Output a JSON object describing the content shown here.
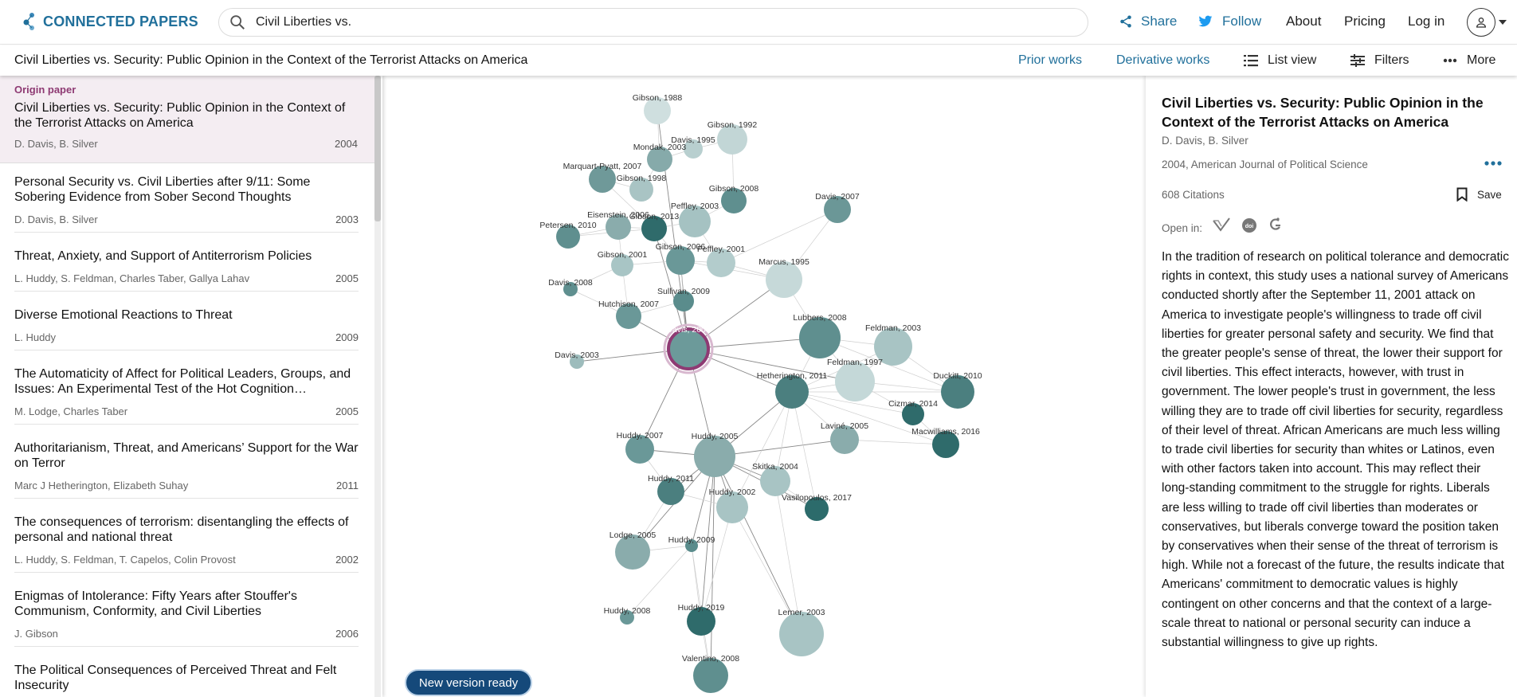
{
  "header": {
    "brand": "CONNECTED PAPERS",
    "search_value": "Civil Liberties vs.",
    "share": "Share",
    "follow": "Follow",
    "about": "About",
    "pricing": "Pricing",
    "login": "Log in",
    "colors": {
      "brand_blue": "#21709b",
      "twitter_blue": "#1d9bf0"
    }
  },
  "subbar": {
    "paper_title": "Civil Liberties vs. Security: Public Opinion in the Context of the Terrorist Attacks on America",
    "prior_works": "Prior works",
    "derivative_works": "Derivative works",
    "list_view": "List view",
    "filters": "Filters",
    "more": "More"
  },
  "list": {
    "origin_tag": "Origin paper",
    "items": [
      {
        "title": "Civil Liberties vs. Security: Public Opinion in the Context of the Terrorist Attacks on America",
        "authors": "D. Davis, B. Silver",
        "year": "2004"
      },
      {
        "title": "Personal Security vs. Civil Liberties after 9/11: Some Sobering Evidence from Sober Second Thoughts",
        "authors": "D. Davis, B. Silver",
        "year": "2003"
      },
      {
        "title": "Threat, Anxiety, and Support of Antiterrorism Policies",
        "authors": "L. Huddy, S. Feldman, Charles Taber, Gallya Lahav",
        "year": "2005"
      },
      {
        "title": "Diverse Emotional Reactions to Threat",
        "authors": "L. Huddy",
        "year": "2009"
      },
      {
        "title": "The Automaticity of Affect for Political Leaders, Groups, and Issues: An Experimental Test of the Hot Cognition…",
        "authors": "M. Lodge, Charles Taber",
        "year": "2005"
      },
      {
        "title": "Authoritarianism, Threat, and Americans’ Support for the War on Terror",
        "authors": "Marc J Hetherington, Elizabeth Suhay",
        "year": "2011"
      },
      {
        "title": "The consequences of terrorism: disentangling the effects of personal and national threat",
        "authors": "L. Huddy, S. Feldman, T. Capelos, Colin Provost",
        "year": "2002"
      },
      {
        "title": "Enigmas of Intolerance: Fifty Years after Stouffer's Communism, Conformity, and Civil Liberties",
        "authors": "J. Gibson",
        "year": "2006"
      },
      {
        "title": "The Political Consequences of Perceived Threat and Felt Insecurity",
        "authors": "",
        "year": ""
      }
    ]
  },
  "graph": {
    "new_version": "New version ready",
    "nodes": [
      "Gibson, 1988",
      "Gibson, 1992",
      "Davis, 1995",
      "Mondak, 2003",
      "Marquart-Pyatt, 2007",
      "Gibson, 1998",
      "Gibson, 2008",
      "Davis, 2007",
      "Peffley, 2003",
      "Eisenstein, 2006",
      "Gibson, 2013",
      "Petersen, 2010",
      "Gibson, 2006",
      "Peffley, 2001",
      "Gibson, 2001",
      "Marcus, 1995",
      "Davis, 2008",
      "Sullivan, 2009",
      "Hutchison, 2007",
      "Lubbers, 2008",
      "Feldman, 2003",
      "Davis, 2004",
      "Davis, 2003",
      "Feldman, 1997",
      "Hetherington, 2011",
      "Duckitt, 2010",
      "Cizmar, 2014",
      "Laviné, 2005",
      "Macwilliams, 2016",
      "Huddy, 2007",
      "Huddy, 2005",
      "Skitka, 2004",
      "Huddy, 2011",
      "Huddy, 2002",
      "Vasilopoulos, 2017",
      "Huddy, 2009",
      "Lodge, 2005",
      "Huddy, 2008",
      "Huddy, 2019",
      "Lerner, 2003",
      "Valentino, 2008"
    ]
  },
  "detail": {
    "title": "Civil Liberties vs. Security: Public Opinion in the Context of the Terrorist Attacks on America",
    "authors": "D. Davis, B. Silver",
    "venue": "2004, American Journal of Political Science",
    "citations": "608 Citations",
    "save": "Save",
    "open_in": "Open in:",
    "abstract": "In the tradition of research on political tolerance and democratic rights in context, this study uses a national survey of Americans conducted shortly after the September 11, 2001 attack on America to investigate people's willingness to trade off civil liberties for greater personal safety and security. We find that the greater people's sense of threat, the lower their support for civil liberties. This effect interacts, however, with trust in government. The lower people's trust in government, the less willing they are to trade off civil liberties for security, regardless of their level of threat. African Americans are much less willing to trade civil liberties for security than whites or Latinos, even with other factors taken into account. This may reflect their long-standing commitment to the struggle for rights. Liberals are less willing to trade off civil liberties than moderates or conservatives, but liberals converge toward the position taken by conservatives when their sense of the threat of terrorism is high. While not a forecast of the future, the results indicate that Americans' commitment to democratic values is highly contingent on other concerns and that the context of a large-scale threat to national or personal security can induce a substantial willingness to give up rights."
  }
}
